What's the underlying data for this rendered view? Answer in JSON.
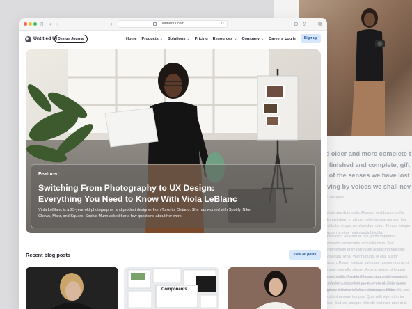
{
  "browser": {
    "url": "untitledui.com",
    "colors": {
      "close": "#ff5f57",
      "minimize": "#febc2e",
      "maximize": "#28c840"
    }
  },
  "nav": {
    "brand": "Untitled UI",
    "badge": "Design Journal",
    "items": [
      {
        "label": "Home",
        "dropdown": false
      },
      {
        "label": "Products",
        "dropdown": true
      },
      {
        "label": "Solutions",
        "dropdown": true
      },
      {
        "label": "Pricing",
        "dropdown": false
      },
      {
        "label": "Resources",
        "dropdown": true
      },
      {
        "label": "Company",
        "dropdown": true
      },
      {
        "label": "Careers",
        "dropdown": true
      }
    ],
    "login": "Log in",
    "signup": "Sign up"
  },
  "hero": {
    "tag": "Featured",
    "title": "Switching From Photography to UX Design: Everything You Need to Know With Viola LeBlanc",
    "description": "Viola LeBlanc is a 23-year-old photographer and product designer from Toronto, Ontario. She has worked with Spotify, Nike, Chews, Makr, and Square. Sophia Munn asked her a few questions about her work."
  },
  "recent": {
    "heading": "Recent blog posts",
    "view_all": "View all posts",
    "cards": [
      {
        "image": "portrait-blonde-woman"
      },
      {
        "image": "components-ui-screens",
        "label": "Components"
      },
      {
        "image": "portrait-woman-white-top"
      }
    ]
  },
  "background_page": {
    "quote_lines": [
      "ld older and more complete t",
      "e finished and complete, gift",
      "s of the senses we have lost",
      "living by voices we shall nev"
    ],
    "caption": "uct Designer",
    "paragraphs": [
      "e dolor sed duis nulla. Aliquam vestibulum, nulla odio nisl vitae. In aliquet pellentesque aenean hac vestibulum turpis mi bibendum diam. Tempor integer aliquam in vitae malesuada fringilla.",
      "ed nisi nim. Pulvinar at orci, proin imperdiet commodo consectetur convallis risus. Sed condimentum enim dignissim adipiscing faucibus consequat, urna. Viverra purus et erat auctor aliquam. Risus, volutpat vulputate posuere purus sit congue convallis aliquet. Arcu id augue ut feugiat donec porttitor neque. Mauris, neque ultricies eu vestibulum, bibendum quam lorem id. Dolor lacus, eget nunc lectus in tellus, pharetra, porttitor.",
      "e amet nulla. Gravida id gravida ac enim mauris id. Non pellentesque congue eget consectetur turpis. Sapien, dictum molestie sem tempor. Diam elit, orci, tincidunt aenean tempus. Quis velit eget ut tortor tellus. Sed vel, congue felis elit erat nam nibh orci."
    ]
  }
}
